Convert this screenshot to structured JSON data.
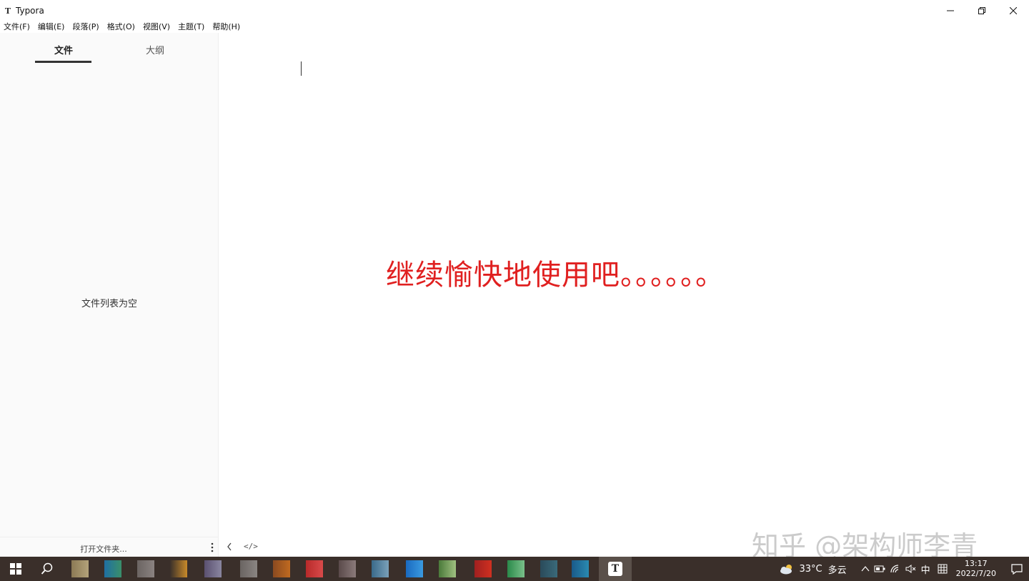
{
  "window": {
    "title": "Typora",
    "app_icon_letter": "T"
  },
  "menu": [
    {
      "label": "文件(F)"
    },
    {
      "label": "编辑(E)"
    },
    {
      "label": "段落(P)"
    },
    {
      "label": "格式(O)"
    },
    {
      "label": "视图(V)"
    },
    {
      "label": "主题(T)"
    },
    {
      "label": "帮助(H)"
    }
  ],
  "sidebar": {
    "tabs": [
      {
        "label": "文件",
        "active": true
      },
      {
        "label": "大纲",
        "active": false
      }
    ],
    "empty_message": "文件列表为空",
    "open_folder_label": "打开文件夹..."
  },
  "editor": {
    "code_toggle_label": "</>"
  },
  "overlay": {
    "text": "继续愉快地使用吧。。。。。。",
    "color": "#e02020"
  },
  "watermark": {
    "text": "知乎 @架构师李青"
  },
  "taskbar": {
    "typora_letter": "T",
    "weather": {
      "temp": "33°C",
      "desc": "多云"
    },
    "ime_label": "中",
    "clock_time": "13:17",
    "clock_date": "2022/7/20"
  }
}
